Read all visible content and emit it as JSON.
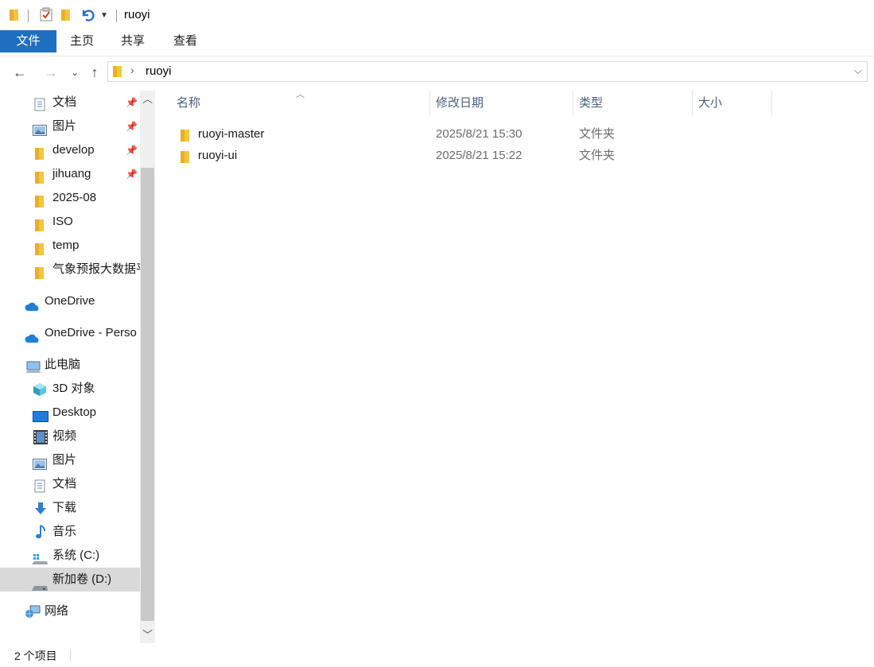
{
  "window": {
    "title": "ruoyi"
  },
  "ribbon": {
    "tabs": [
      {
        "label": "文件"
      },
      {
        "label": "主页"
      },
      {
        "label": "共享"
      },
      {
        "label": "查看"
      }
    ]
  },
  "address": {
    "path": [
      "ruoyi"
    ]
  },
  "nav": {
    "items": [
      {
        "label": "文档",
        "icon": "documents-icon",
        "pinned": true
      },
      {
        "label": "图片",
        "icon": "pictures-icon",
        "pinned": true
      },
      {
        "label": "develop",
        "icon": "folder-icon",
        "pinned": true
      },
      {
        "label": "jihuang",
        "icon": "folder-icon",
        "pinned": true
      },
      {
        "label": "2025-08",
        "icon": "folder-icon"
      },
      {
        "label": "ISO",
        "icon": "folder-icon"
      },
      {
        "label": "temp",
        "icon": "folder-icon"
      },
      {
        "label": "气象预报大数据平",
        "icon": "folder-icon"
      },
      {
        "label": "OneDrive",
        "icon": "onedrive-icon"
      },
      {
        "label": "OneDrive - Perso",
        "icon": "onedrive-icon"
      },
      {
        "label": "此电脑",
        "icon": "this-pc-icon"
      },
      {
        "label": "3D 对象",
        "icon": "3d-objects-icon"
      },
      {
        "label": "Desktop",
        "icon": "desktop-icon"
      },
      {
        "label": "视频",
        "icon": "videos-icon"
      },
      {
        "label": "图片",
        "icon": "pictures-icon"
      },
      {
        "label": "文档",
        "icon": "documents-icon"
      },
      {
        "label": "下载",
        "icon": "downloads-icon"
      },
      {
        "label": "音乐",
        "icon": "music-icon"
      },
      {
        "label": "系统 (C:)",
        "icon": "system-drive-icon"
      },
      {
        "label": "新加卷 (D:)",
        "icon": "drive-icon",
        "selected": true
      },
      {
        "label": "网络",
        "icon": "network-icon"
      }
    ]
  },
  "columns": [
    {
      "label": "名称"
    },
    {
      "label": "修改日期"
    },
    {
      "label": "类型"
    },
    {
      "label": "大小"
    }
  ],
  "files": [
    {
      "name": "ruoyi-master",
      "modified": "2025/8/21 15:30",
      "type": "文件夹",
      "size": ""
    },
    {
      "name": "ruoyi-ui",
      "modified": "2025/8/21 15:22",
      "type": "文件夹",
      "size": ""
    }
  ],
  "status": {
    "item_count": "2 个项目"
  },
  "colors": {
    "accent": "#1e6fc0",
    "folder": "#f4c542",
    "selected": "#d9d9d9"
  }
}
